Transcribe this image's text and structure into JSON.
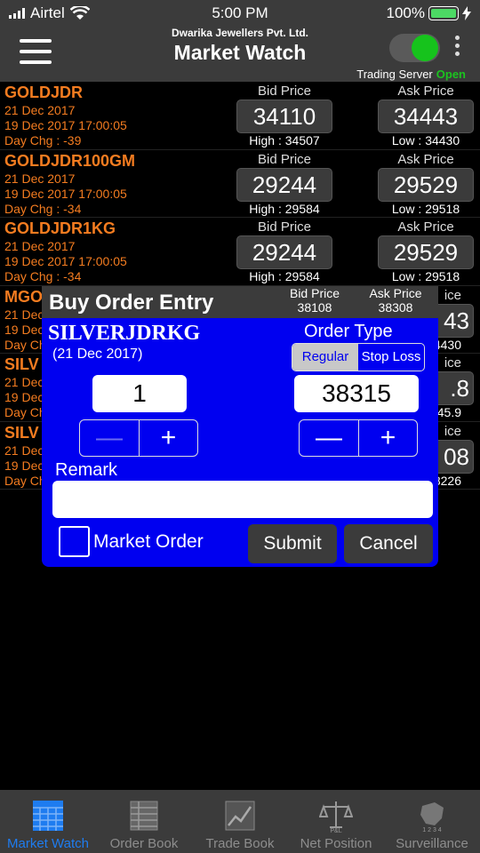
{
  "status": {
    "carrier": "Airtel",
    "time": "5:00 PM",
    "battery": "100%"
  },
  "header": {
    "company": "Dwarika Jewellers Pvt. Ltd.",
    "title": "Market Watch",
    "server_label": "Trading Server",
    "server_status": "Open"
  },
  "rows": [
    {
      "symbol": "GOLDJDR",
      "expiry": "21 Dec 2017",
      "updated": "19 Dec 2017 17:00:05",
      "chg": "Day Chg :  -39",
      "bid_label": "Bid Price",
      "ask_label": "Ask Price",
      "bid": "34110",
      "ask": "34443",
      "high": "High : 34507",
      "low": "Low : 34430"
    },
    {
      "symbol": "GOLDJDR100GM",
      "expiry": "21 Dec 2017",
      "updated": "19 Dec 2017 17:00:05",
      "chg": "Day Chg :  -34",
      "bid_label": "Bid Price",
      "ask_label": "Ask Price",
      "bid": "29244",
      "ask": "29529",
      "high": "High : 29584",
      "low": "Low : 29518"
    },
    {
      "symbol": "GOLDJDR1KG",
      "expiry": "21 Dec 2017",
      "updated": "19 Dec 2017 17:00:05",
      "chg": "Day Chg :  -34",
      "bid_label": "Bid Price",
      "ask_label": "Ask Price",
      "bid": "29244",
      "ask": "29529",
      "high": "High : 29584",
      "low": "Low : 29518"
    },
    {
      "symbol": "MGO",
      "expiry": "21 Dec",
      "updated": "19 Dec",
      "chg": "Day Ch",
      "bid_label": "",
      "ask_label": "ice",
      "bid": "",
      "ask": "43",
      "high": "",
      "low": "4430"
    },
    {
      "symbol": "SILV",
      "expiry": "21 Dec",
      "updated": "19 Dec",
      "chg": "Day Ch",
      "bid_label": "",
      "ask_label": "ice",
      "bid": "",
      "ask": ".8",
      "high": "",
      "low": "45.9"
    },
    {
      "symbol": "SILV",
      "expiry": "21 Dec",
      "updated": "19 Dec",
      "chg": "Day Ch",
      "bid_label": "",
      "ask_label": "ice",
      "bid": "",
      "ask": "08",
      "high": "",
      "low": "8226"
    }
  ],
  "dialog": {
    "title": "Buy Order Entry",
    "bid_label": "Bid Price",
    "bid": "38108",
    "ask_label": "Ask Price",
    "ask": "38308",
    "symbol": "SILVERJDRKG",
    "expiry": "(21 Dec 2017)",
    "order_type_label": "Order Type",
    "order_types": [
      "Regular",
      "Stop Loss"
    ],
    "quantity": "1",
    "price": "38315",
    "minus": "—",
    "plus": "+",
    "remark_label": "Remark",
    "remark_value": "",
    "market_order_label": "Market Order",
    "submit": "Submit",
    "cancel": "Cancel"
  },
  "tabs": [
    {
      "label": "Market Watch",
      "icon": "grid-icon"
    },
    {
      "label": "Order Book",
      "icon": "book-icon"
    },
    {
      "label": "Trade Book",
      "icon": "chart-icon"
    },
    {
      "label": "Net Position",
      "icon": "scale-icon"
    },
    {
      "label": "Surveillance",
      "icon": "map-icon"
    }
  ],
  "colors": {
    "accent_orange": "#f47c20",
    "dialog_blue": "#0000f0",
    "open_green": "#1bc41f",
    "active_tab": "#1e7cf0"
  }
}
